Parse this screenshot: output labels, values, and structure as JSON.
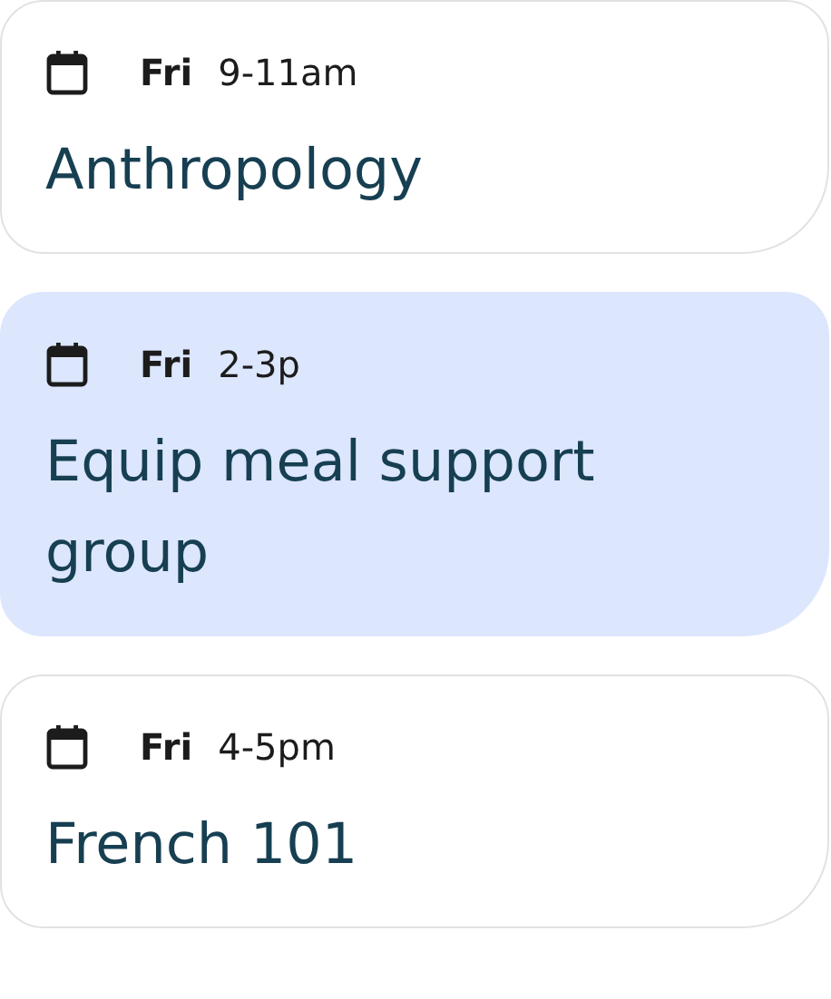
{
  "events": [
    {
      "day": "Fri",
      "time": "9-11am",
      "title": "Anthropology",
      "selected": false
    },
    {
      "day": "Fri",
      "time": "2-3p",
      "title": "Equip meal support group",
      "selected": true
    },
    {
      "day": "Fri",
      "time": "4-5pm",
      "title": "French 101",
      "selected": false
    }
  ]
}
